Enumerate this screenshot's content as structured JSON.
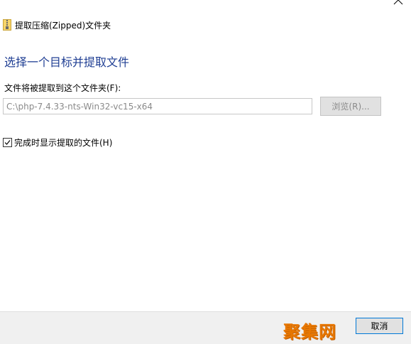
{
  "window": {
    "title": "提取压缩(Zipped)文件夹",
    "close_glyph": "close-icon"
  },
  "main": {
    "heading": "选择一个目标并提取文件",
    "destination_label": "文件将被提取到这个文件夹(F):",
    "destination_value": "C:\\php-7.4.33-nts-Win32-vc15-x64",
    "browse_label": "浏览(R)...",
    "show_files_label": "完成时显示提取的文件(H)",
    "show_files_checked": true
  },
  "footer": {
    "watermark": "聚集网",
    "cancel_label": "取消"
  },
  "colors": {
    "heading": "#1f3e93",
    "footer_bg": "#f0f0f0",
    "cancel_border": "#0078d7",
    "watermark": "#e87700"
  }
}
